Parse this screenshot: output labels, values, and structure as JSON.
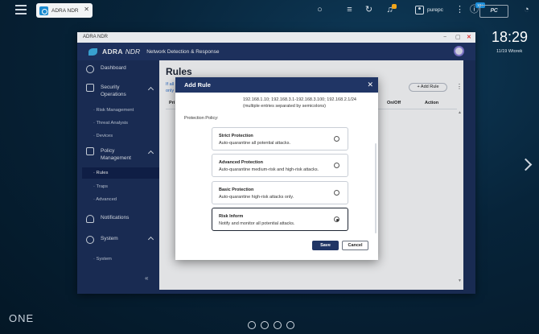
{
  "taskbar": {
    "tab_label": "ADRA NDR",
    "tab_close": "✕",
    "user": "purepc",
    "notification_count": "3",
    "firmware_badge": "10+",
    "logo_text": "PC"
  },
  "clock": {
    "time": "18:29",
    "date": "11/19 Wtorek"
  },
  "window": {
    "title": "ADRA NDR",
    "controls": [
      "−",
      "▢",
      "✕"
    ],
    "brand": "ADRA",
    "brand_suffix": "NDR",
    "subtitle": "Network Detection & Response"
  },
  "sidebar": {
    "dashboard": "Dashboard",
    "security_ops": [
      "Security",
      "Operations"
    ],
    "security_children": [
      "Risk Management",
      "Threat Analysis",
      "Devices"
    ],
    "policy_mgmt": [
      "Policy",
      "Management"
    ],
    "policy_children": [
      "Rules",
      "Traps",
      "Advanced"
    ],
    "notifications": "Notifications",
    "system": "System",
    "system_children": [
      "System"
    ],
    "collapse": "«"
  },
  "content": {
    "title": "Rules",
    "info": "If all only",
    "add_rule": "+ Add Rule",
    "more": "⋮",
    "columns": {
      "first": "Pri",
      "on_off": "On/Off",
      "action": "Action"
    }
  },
  "modal": {
    "title": "Add Rule",
    "close": "✕",
    "ip_line": "192.168.1.10; 192.168.3.1-192.168.3.100; 192.168.2.1/24",
    "ip_hint": "(multiple entries separated by semicolons)",
    "policy_label": "Protection Policy:",
    "options": [
      {
        "title": "Strict Protection",
        "desc": "Auto-quarantine all potential attacks.",
        "selected": false
      },
      {
        "title": "Advanced Protection",
        "desc": "Auto-quarantine medium-risk and high-risk attacks.",
        "selected": false
      },
      {
        "title": "Basic Protection",
        "desc": "Auto-quarantine high-risk attacks only.",
        "selected": false
      },
      {
        "title": "Risk Inform",
        "desc": "Notify and monitor all potential attacks.",
        "selected": true
      }
    ],
    "save": "Save",
    "cancel": "Cancel"
  },
  "desktop": {
    "brand": "ONE"
  },
  "icons": [
    "menu-icon",
    "search-icon",
    "news-icon",
    "sync-icon",
    "bell-icon",
    "user-icon",
    "more-icon",
    "dashboard-icon",
    "security-icon",
    "policy-icon",
    "notifications-icon",
    "system-icon"
  ]
}
